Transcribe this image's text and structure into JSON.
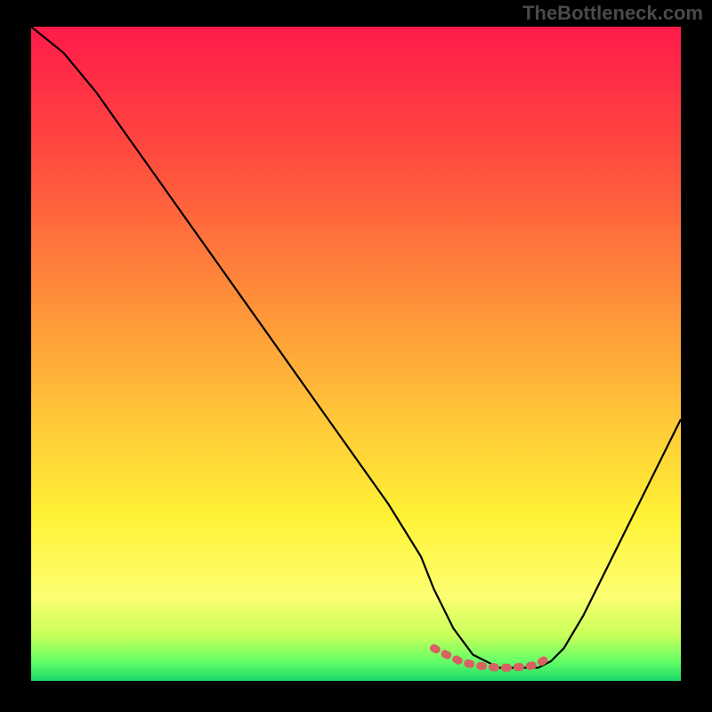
{
  "watermark": "TheBottleneck.com",
  "chart_data": {
    "type": "line",
    "title": "",
    "xlabel": "",
    "ylabel": "",
    "xlim": [
      0,
      100
    ],
    "ylim": [
      0,
      100
    ],
    "grid": false,
    "series": [
      {
        "name": "curve",
        "x": [
          0,
          5,
          10,
          15,
          20,
          25,
          30,
          35,
          40,
          45,
          50,
          55,
          60,
          62,
          65,
          68,
          72,
          76,
          78,
          80,
          82,
          85,
          88,
          91,
          94,
          97,
          100
        ],
        "y": [
          100,
          96,
          90,
          83,
          76,
          69,
          62,
          55,
          48,
          41,
          34,
          27,
          19,
          14,
          8,
          4,
          2,
          2,
          2,
          3,
          5,
          10,
          16,
          22,
          28,
          34,
          40
        ]
      }
    ],
    "highlight": {
      "name": "bottleneck-zone",
      "color": "#d86262",
      "x": [
        62,
        63.5,
        65,
        66,
        67.5,
        69,
        71,
        73,
        75,
        77,
        78,
        79
      ],
      "y": [
        5,
        4.2,
        3.5,
        3,
        2.6,
        2.3,
        2.1,
        2.0,
        2.1,
        2.3,
        2.6,
        3.2
      ]
    },
    "background_gradient_deg": [
      {
        "offset": 0,
        "color": "#ff1a4a"
      },
      {
        "offset": 20,
        "color": "#ff4c3f"
      },
      {
        "offset": 40,
        "color": "#ff8a3a"
      },
      {
        "offset": 60,
        "color": "#ffc738"
      },
      {
        "offset": 75,
        "color": "#fff236"
      },
      {
        "offset": 87,
        "color": "#fdff72"
      },
      {
        "offset": 93,
        "color": "#c9ff5a"
      },
      {
        "offset": 97,
        "color": "#66ff66"
      },
      {
        "offset": 100,
        "color": "#18d86a"
      }
    ]
  }
}
